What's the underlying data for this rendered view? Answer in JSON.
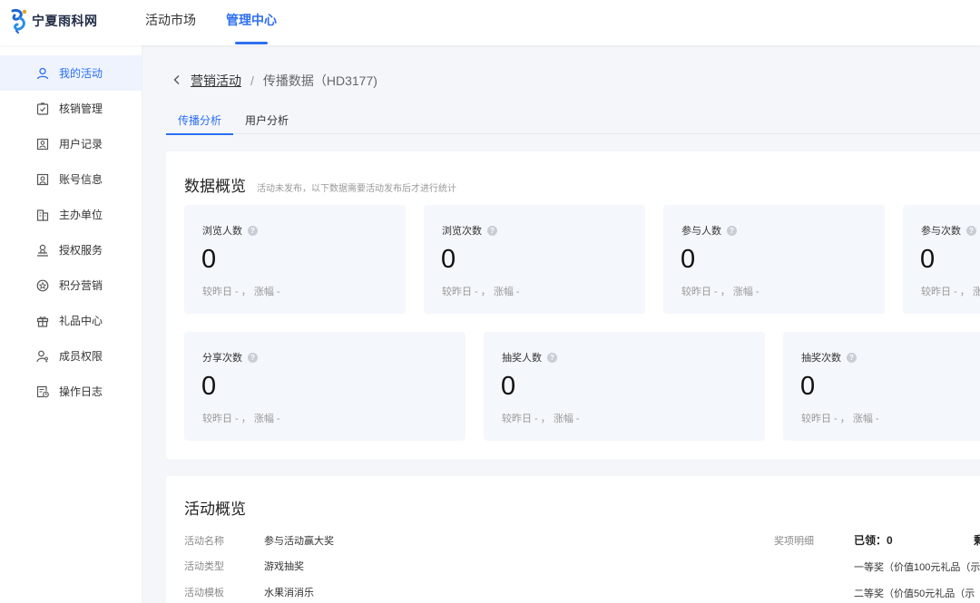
{
  "brand": {
    "name": "宁夏雨科网"
  },
  "nav": {
    "items": [
      "活动市场",
      "管理中心"
    ],
    "active": 1
  },
  "sidebar": {
    "items": [
      {
        "label": "我的活动",
        "icon": "user-icon"
      },
      {
        "label": "核销管理",
        "icon": "verify-icon"
      },
      {
        "label": "用户记录",
        "icon": "user-record-icon"
      },
      {
        "label": "账号信息",
        "icon": "account-icon"
      },
      {
        "label": "主办单位",
        "icon": "building-icon"
      },
      {
        "label": "授权服务",
        "icon": "authorize-icon"
      },
      {
        "label": "积分营销",
        "icon": "points-icon"
      },
      {
        "label": "礼品中心",
        "icon": "gift-icon"
      },
      {
        "label": "成员权限",
        "icon": "member-key-icon"
      },
      {
        "label": "操作日志",
        "icon": "log-icon"
      }
    ],
    "active": 0
  },
  "breadcrumb": {
    "parent": "营销活动",
    "separator": "/",
    "current": "传播数据（HD3177)"
  },
  "tabs": [
    "传播分析",
    "用户分析"
  ],
  "overview": {
    "title": "数据概览",
    "hint": "活动未发布，以下数据需要活动发布后才进行统计",
    "compare_text": "较昨日 - ， 涨幅 -",
    "stats": [
      {
        "label": "浏览人数",
        "value": "0"
      },
      {
        "label": "浏览次数",
        "value": "0"
      },
      {
        "label": "参与人数",
        "value": "0"
      },
      {
        "label": "参与次数",
        "value": "0"
      },
      {
        "label": "分享次数",
        "value": "0"
      },
      {
        "label": "抽奖人数",
        "value": "0"
      },
      {
        "label": "抽奖次数",
        "value": "0"
      }
    ]
  },
  "activity": {
    "title": "活动概览",
    "fields": [
      {
        "label": "活动名称",
        "value": "参与活动赢大奖"
      },
      {
        "label": "活动类型",
        "value": "游戏抽奖"
      },
      {
        "label": "活动模板",
        "value": "水果消消乐"
      }
    ],
    "prize_label": "奖项明细",
    "claimed": "已领：0",
    "remaining_clip": "剩",
    "prizes": [
      "一等奖（价值100元礼品（示",
      "二等奖（价值50元礼品（示"
    ]
  },
  "colors": {
    "accent": "#2e6ff2",
    "stat_bg": "#f4f7fb"
  }
}
